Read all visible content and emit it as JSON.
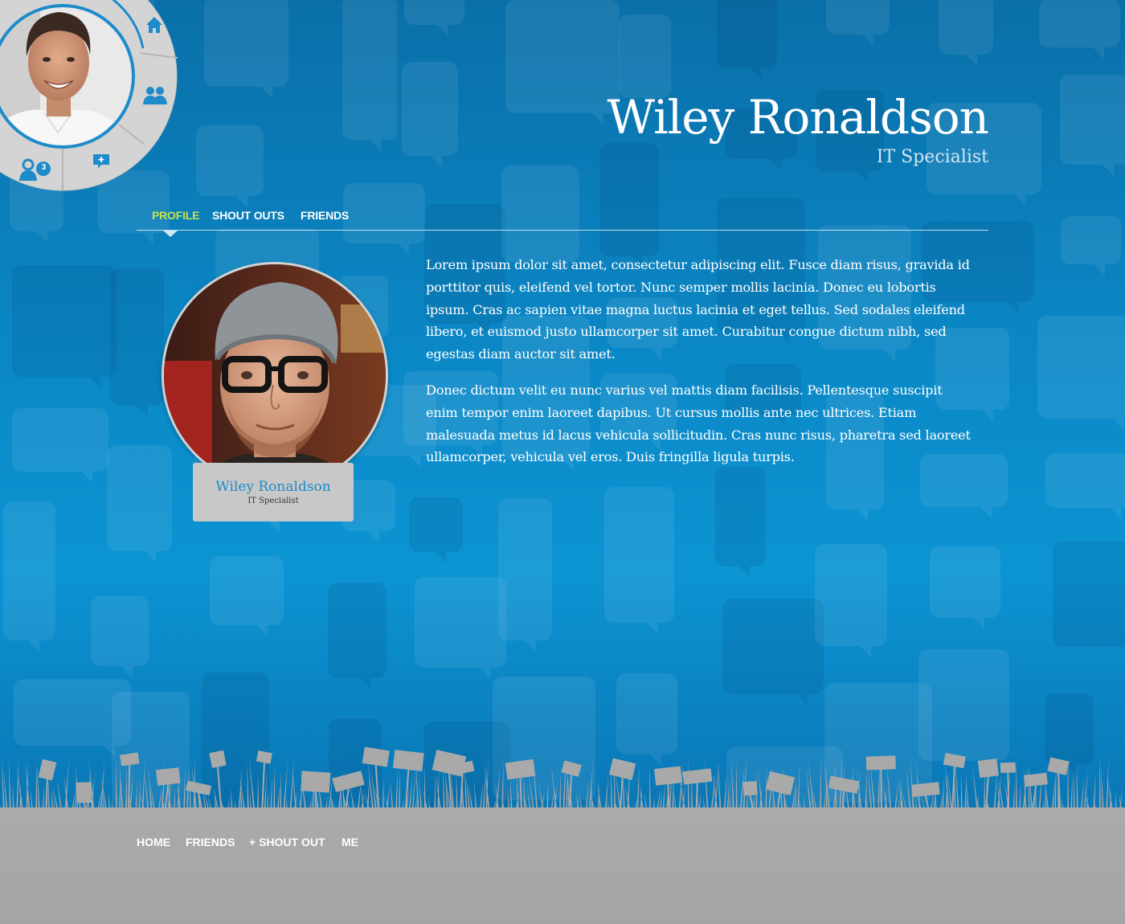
{
  "header": {
    "name": "Wiley Ronaldson",
    "title": "IT Specialist"
  },
  "corner_menu": {
    "items": [
      {
        "name": "home-icon"
      },
      {
        "name": "friends-icon"
      },
      {
        "name": "shout-out-icon"
      },
      {
        "name": "friend-requests-icon",
        "badge": "3"
      }
    ]
  },
  "tabs": [
    {
      "label": "PROFILE",
      "active": true
    },
    {
      "label": "SHOUT OUTS",
      "active": false
    },
    {
      "label": "FRIENDS",
      "active": false
    }
  ],
  "profile_card": {
    "name": "Wiley Ronaldson",
    "title": "IT Specialist"
  },
  "bio": {
    "paragraphs": [
      "Lorem ipsum dolor sit amet, consectetur adipiscing elit. Fusce diam risus, gravida id porttitor quis, eleifend vel tortor. Nunc semper mollis lacinia. Donec eu lobortis ipsum. Cras ac sapien vitae magna luctus lacinia et eget tellus. Sed sodales eleifend libero, et euismod justo ullamcorper sit amet. Curabitur congue dictum nibh, sed egestas diam auctor sit amet.",
      "Donec dictum velit eu nunc varius vel mattis diam facilisis. Pellentesque suscipit enim tempor enim laoreet dapibus. Ut cursus mollis ante nec ultrices. Etiam malesuada metus id lacus vehicula sollicitudin. Cras nunc risus, pharetra sed laoreet ullamcorper, vehicula vel eros. Duis fringilla ligula turpis."
    ]
  },
  "footer_nav": [
    {
      "label": "HOME"
    },
    {
      "label": "FRIENDS"
    },
    {
      "label": "+ SHOUT OUT"
    },
    {
      "label": "ME"
    }
  ],
  "colors": {
    "accent": "#c6e24a",
    "brand_blue": "#1a8cc8",
    "ground": "#a8a8a8"
  }
}
